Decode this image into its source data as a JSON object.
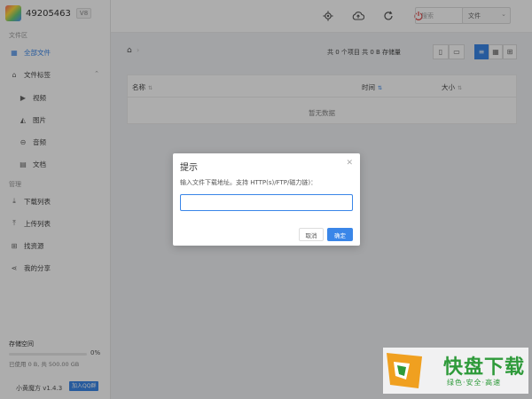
{
  "sidebar": {
    "user_id": "49205463",
    "vip_label": "V8",
    "section_files": "文件区",
    "all_files": "全部文件",
    "file_tags": "文件标签",
    "sub_items": [
      "视频",
      "图片",
      "音频",
      "文档"
    ],
    "section_manage": "管理",
    "download_list": "下载列表",
    "upload_list": "上传列表",
    "find_resources": "找资源",
    "my_shares": "我的分享",
    "storage_title": "存储空间",
    "storage_percent": "0%",
    "storage_fraction": 0,
    "storage_used": "已使用 0 B, 共 500.00 GB",
    "version": "小黄魔方 v1.4.3",
    "qq_button": "加入QQ群"
  },
  "topbar": {
    "search_placeholder": "搜索",
    "search_type": "文件"
  },
  "content": {
    "stats": "共 0 个项目  共 0 B 存储量",
    "columns": {
      "name": "名称",
      "time": "时间",
      "size": "大小"
    },
    "empty_text": "暂无数据"
  },
  "dialog": {
    "title": "提示",
    "message": "输入文件下载地址。支持 HTTP(s)/FTP/磁力链)：",
    "input_value": "",
    "cancel_label": "取消",
    "ok_label": "确定"
  },
  "watermark": {
    "title": "快盘下载",
    "subtitle": "绿色·安全·高速"
  },
  "colors": {
    "accent": "#3a86e8",
    "power": "#e04545",
    "watermark_green": "#2e9a3a"
  }
}
